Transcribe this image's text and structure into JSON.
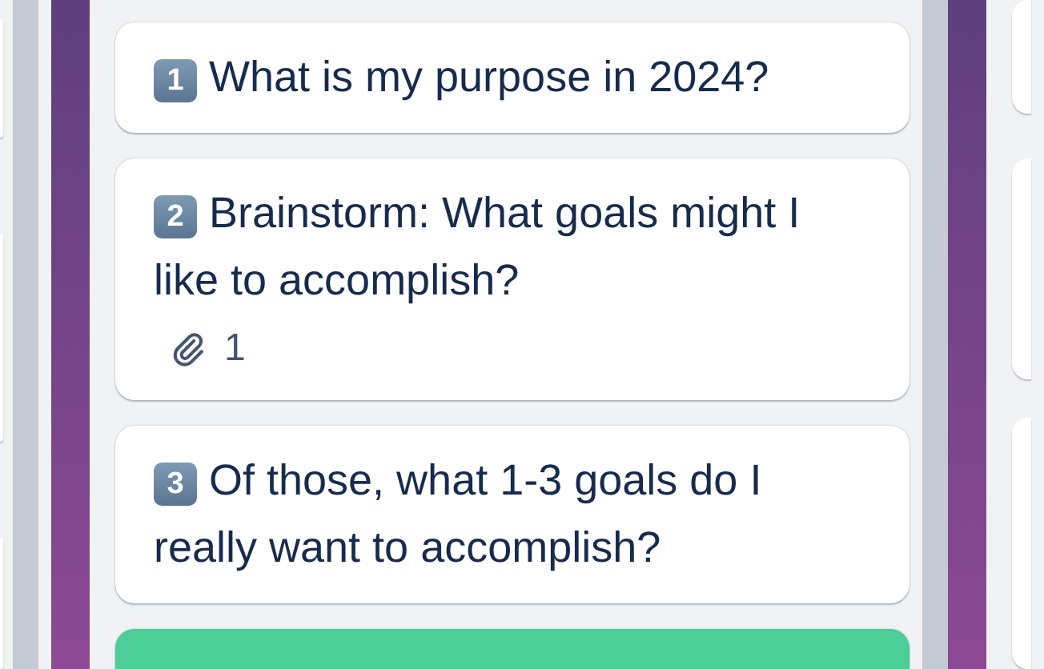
{
  "cards": [
    {
      "number": "1",
      "title": "What is my purpose in 2024?"
    },
    {
      "number": "2",
      "title": "Brainstorm: What goals might I like to accomplish?",
      "attachments": "1"
    },
    {
      "number": "3",
      "title": "Of those, what 1-3 goals do I really want to accomplish?"
    }
  ]
}
